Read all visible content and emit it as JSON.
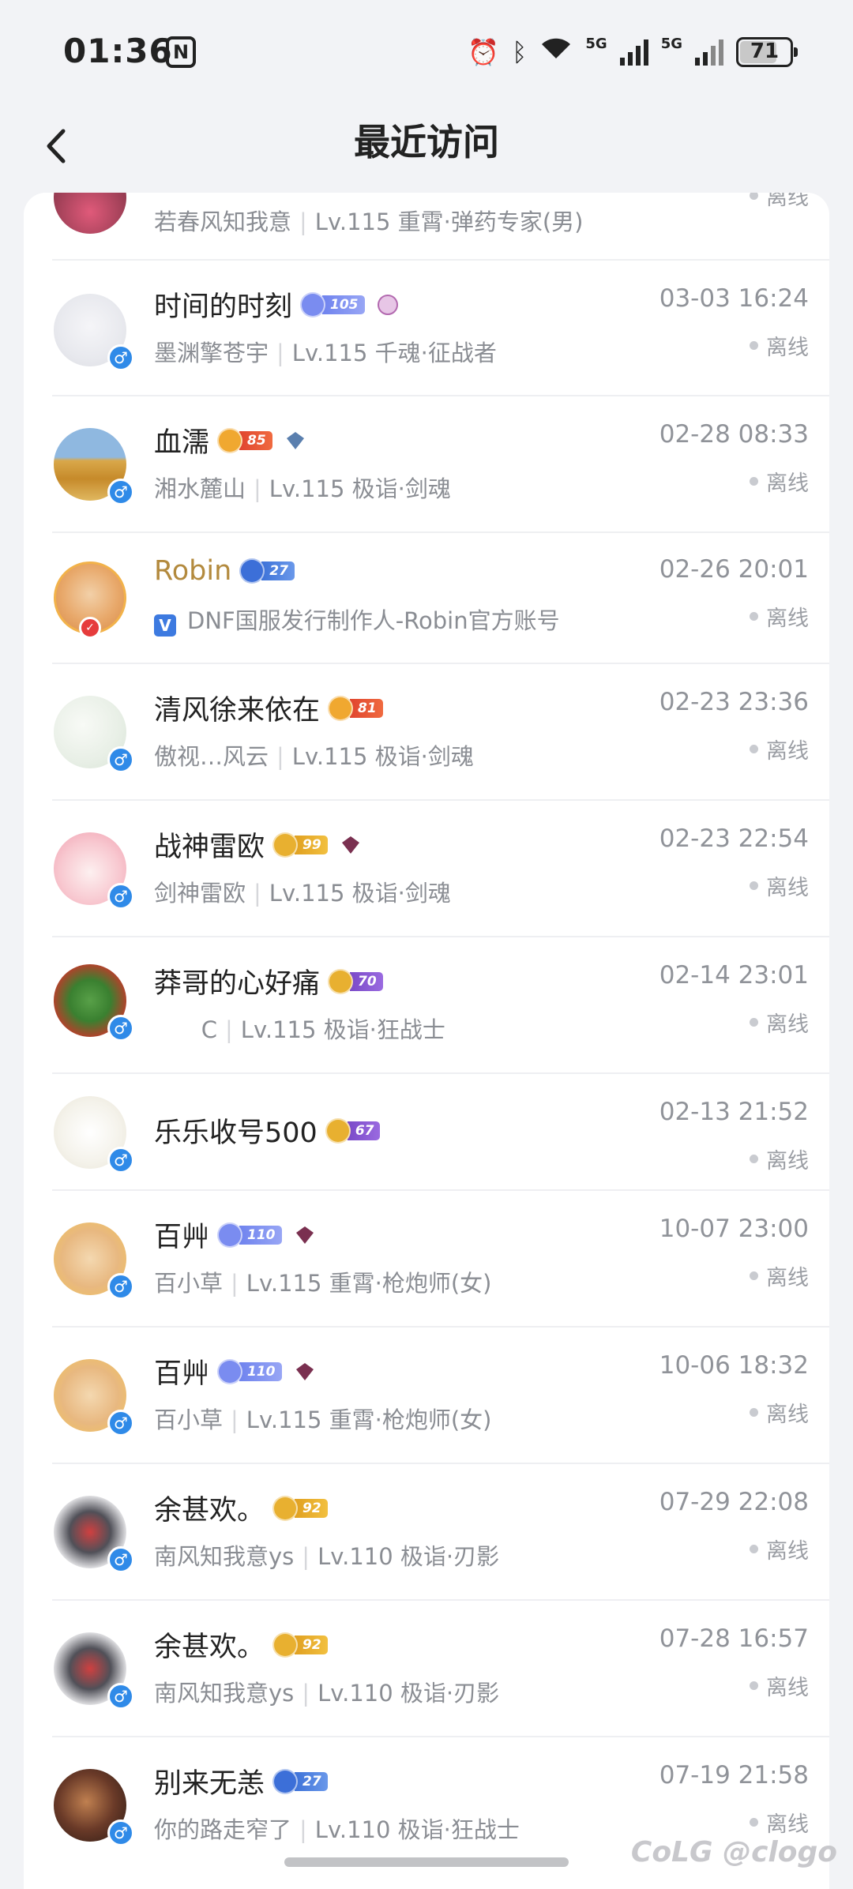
{
  "status_bar": {
    "time": "01:36",
    "battery": "71",
    "net1": "5G",
    "net2": "5G"
  },
  "header": {
    "title": "最近访问"
  },
  "visitors": [
    {
      "name": "",
      "sub_name": "若春风知我意",
      "sub_info": "Lv.115 重霄·弹药专家(男)",
      "time": "",
      "status": "离线"
    },
    {
      "name": "时间的时刻",
      "level": "105",
      "sub_name": "墨渊擎苍宇",
      "sub_info": "Lv.115 千魂·征战者",
      "time": "03-03 16:24",
      "status": "离线"
    },
    {
      "name": "血濡",
      "level": "85",
      "sub_name": "湘水麓山",
      "sub_info": "Lv.115 极诣·剑魂",
      "time": "02-28 08:33",
      "status": "离线"
    },
    {
      "name": "Robin",
      "level": "27",
      "sub_info": "DNF国服发行制作人-Robin官方账号",
      "vbadge": "V",
      "time": "02-26 20:01",
      "status": "离线"
    },
    {
      "name": "清风徐来依在",
      "level": "81",
      "sub_name": "傲视…风云",
      "sub_info": "Lv.115 极诣·剑魂",
      "time": "02-23 23:36",
      "status": "离线"
    },
    {
      "name": "战神雷欧",
      "level": "99",
      "sub_name": "剑神雷欧",
      "sub_info": "Lv.115 极诣·剑魂",
      "time": "02-23 22:54",
      "status": "离线"
    },
    {
      "name": "莽哥的心好痛",
      "level": "70",
      "sub_name": "C",
      "sub_info": "Lv.115 极诣·狂战士",
      "time": "02-14 23:01",
      "status": "离线"
    },
    {
      "name": "乐乐收号500",
      "level": "67",
      "time": "02-13 21:52",
      "status": "离线"
    },
    {
      "name": "百艸",
      "level": "110",
      "sub_name": "百小草",
      "sub_info": "Lv.115 重霄·枪炮师(女)",
      "time": "10-07 23:00",
      "status": "离线"
    },
    {
      "name": "百艸",
      "level": "110",
      "sub_name": "百小草",
      "sub_info": "Lv.115 重霄·枪炮师(女)",
      "time": "10-06 18:32",
      "status": "离线"
    },
    {
      "name": "余甚欢。",
      "level": "92",
      "sub_name": "南风知我意ys",
      "sub_info": "Lv.110 极诣·刃影",
      "time": "07-29 22:08",
      "status": "离线"
    },
    {
      "name": "余甚欢。",
      "level": "92",
      "sub_name": "南风知我意ys",
      "sub_info": "Lv.110 极诣·刃影",
      "time": "07-28 16:57",
      "status": "离线"
    },
    {
      "name": "别来无恙",
      "level": "27",
      "sub_name": "你的路走窄了",
      "sub_info": "Lv.110 极诣·狂战士",
      "time": "07-19 21:58",
      "status": "离线"
    }
  ],
  "watermark": "CoLG @clogo",
  "colors": {
    "accent_blue": "#2f8ae8",
    "gold_name": "#b38a3e",
    "background": "#f2f3f6"
  }
}
